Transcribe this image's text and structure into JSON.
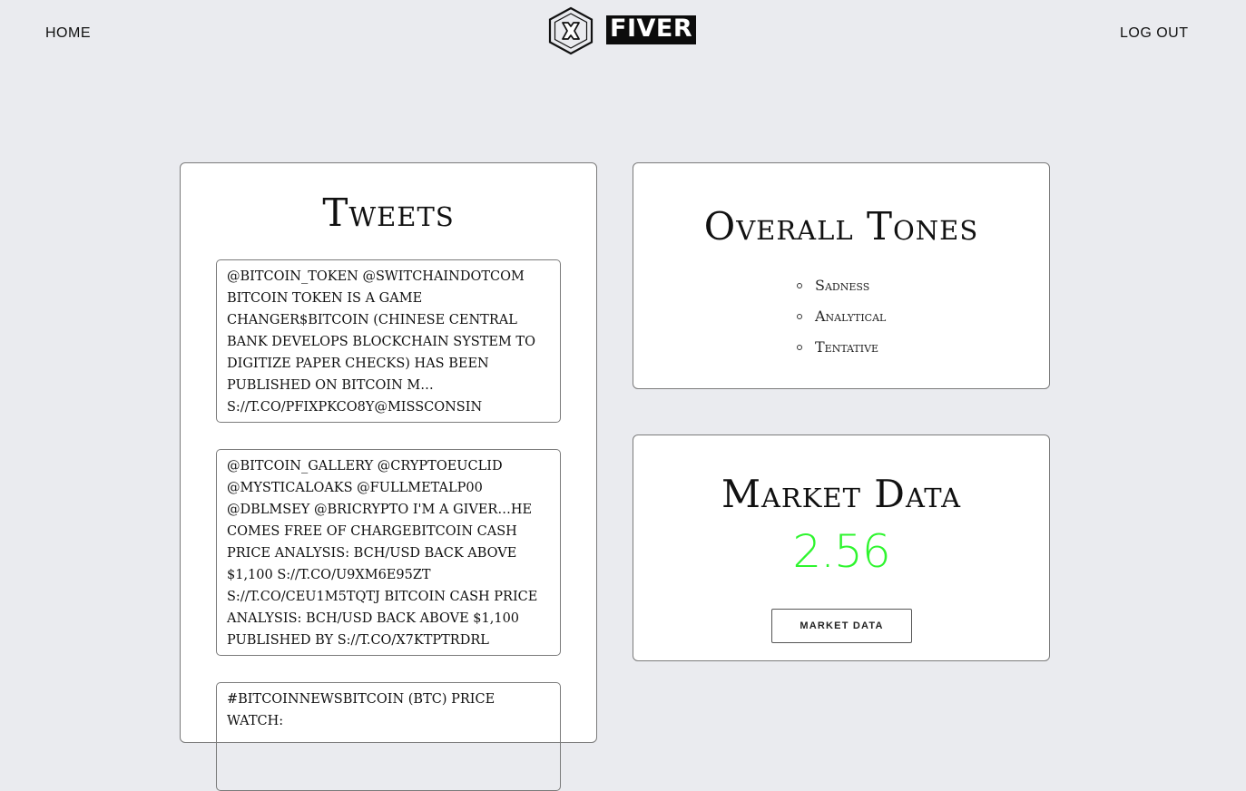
{
  "nav": {
    "home_label": "HOME",
    "logout_label": "LOG OUT"
  },
  "logo": {
    "text": "FIVER",
    "icon": "x-hexagon-icon"
  },
  "tweets": {
    "title": "Tweets",
    "items": [
      "@bitcoin_token @switchaindotcom bitcoin token is a game changer$bitcoin (chinese central bank develops blockchain system to digitize paper checks) has been published on bitcoin m… s://t.co/pfixpkco8y@missconsin",
      "@bitcoin_gallery @cryptoeuclid @mysticaloaks @fullmetalp00 @dblmsey @bricrypto i'm a giver…he comes free of chargebitcoin cash price analysis: bch/usd back above $1,100 s://t.co/u9xm6e95zt s://t.co/ceu1m5tqtj bitcoin cash price analysis: bch/usd back above $1,100 published by s://t.co/x7ktptrdrl",
      "#bitcoinnewsbitcoin (btc) price watch:"
    ]
  },
  "tones": {
    "title": "Overall Tones",
    "items": [
      "Sadness",
      "Analytical",
      "Tentative"
    ]
  },
  "market": {
    "title": "Market Data",
    "value": "2.56",
    "value_color": "#2ef52e",
    "button_label": "MARKET DATA"
  }
}
